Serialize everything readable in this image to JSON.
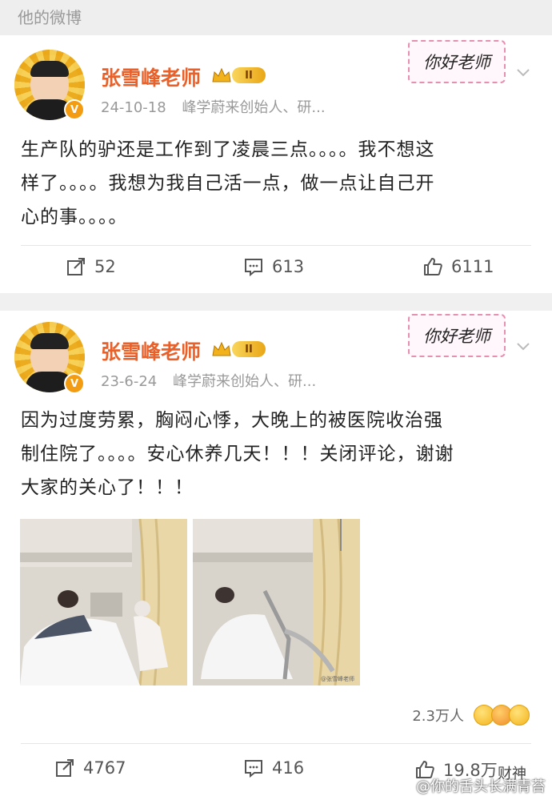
{
  "section": {
    "title": "他的微博"
  },
  "posts": [
    {
      "author": "张雪峰老师",
      "vip_level": "II",
      "date": "24-10-18",
      "source": "峰学蔚来创始人、研...",
      "sticker": "你好老师",
      "text_lines": [
        "生产队的驴还是工作到了凌晨三点。。。。我不想这",
        "样了。。。。我想为我自己活一点，做一点让自己开",
        "心的事。。。。"
      ],
      "reposts": "52",
      "comments": "613",
      "likes": "6111"
    },
    {
      "author": "张雪峰老师",
      "vip_level": "II",
      "date": "23-6-24",
      "source": "峰学蔚来创始人、研...",
      "sticker": "你好老师",
      "text_lines": [
        "因为过度劳累，胸闷心悸，大晚上的被医院收治强",
        "制住院了。。。。安心休养几天！！！关闭评论，谢谢",
        "大家的关心了！！！"
      ],
      "photo_watermark": "@张雪峰老师",
      "reaction_count": "2.3万人",
      "reposts": "4767",
      "comments": "416",
      "likes": "19.8万"
    }
  ],
  "watermark": "@你的舌头长满青苔",
  "overlay_text": "财神",
  "colors": {
    "name": "#e8612b",
    "meta": "#999999",
    "background": "#f0f0f0"
  }
}
